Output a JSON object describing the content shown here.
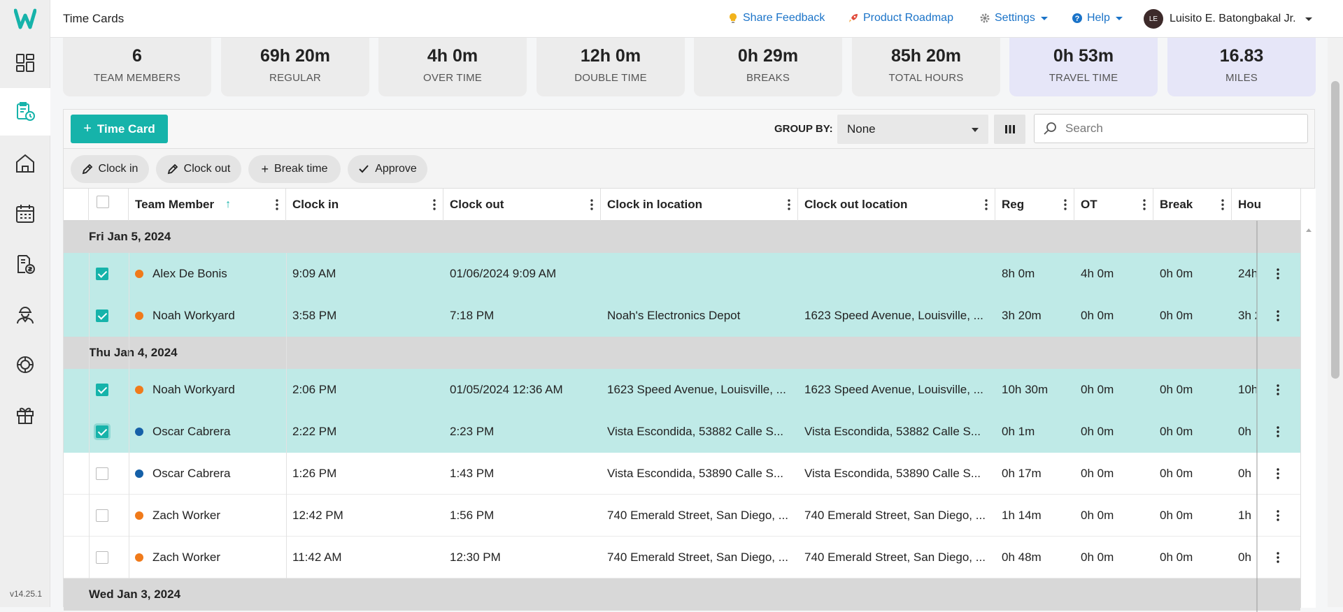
{
  "app": {
    "version": "v14.25.1"
  },
  "header": {
    "title": "Time Cards",
    "links": [
      {
        "label": "Share Feedback"
      },
      {
        "label": "Product Roadmap"
      },
      {
        "label": "Settings"
      },
      {
        "label": "Help"
      }
    ],
    "user": {
      "initials": "LE",
      "name": "Luisito E. Batongbakal Jr."
    }
  },
  "stats": [
    {
      "value": "6",
      "label": "TEAM MEMBERS"
    },
    {
      "value": "69h 20m",
      "label": "REGULAR"
    },
    {
      "value": "4h 0m",
      "label": "OVER TIME"
    },
    {
      "value": "12h 0m",
      "label": "DOUBLE TIME"
    },
    {
      "value": "0h 29m",
      "label": "BREAKS"
    },
    {
      "value": "85h 20m",
      "label": "TOTAL HOURS"
    },
    {
      "value": "0h 53m",
      "label": "TRAVEL TIME"
    },
    {
      "value": "16.83",
      "label": "MILES"
    }
  ],
  "toolbar": {
    "add_label": "Time Card",
    "group_by_label": "GROUP BY:",
    "group_by_value": "None",
    "search_placeholder": "Search"
  },
  "actions": [
    {
      "label": "Clock in"
    },
    {
      "label": "Clock out"
    },
    {
      "label": "Break time"
    },
    {
      "label": "Approve"
    }
  ],
  "columns": [
    "Team Member",
    "Clock in",
    "Clock out",
    "Clock in location",
    "Clock out location",
    "Reg",
    "OT",
    "Break",
    "Hou"
  ],
  "colors": {
    "accent": "#16b3aa",
    "selected_row": "#bfeae7",
    "orange_dot": "#f07a1a",
    "blue_dot": "#1560a8"
  },
  "groups": [
    {
      "label": "Fri Jan 5, 2024",
      "rows": [
        {
          "selected": true,
          "dot": "orange",
          "member": "Alex De Bonis",
          "clock_in": "9:09 AM",
          "clock_out": "01/06/2024 9:09 AM",
          "in_loc": "",
          "out_loc": "",
          "reg": "8h 0m",
          "ot": "4h 0m",
          "brk": "0h 0m",
          "hours": "24h"
        },
        {
          "selected": true,
          "dot": "orange",
          "member": "Noah Workyard",
          "clock_in": "3:58 PM",
          "clock_out": "7:18 PM",
          "in_loc": "Noah's Electronics Depot",
          "out_loc": "1623 Speed Avenue, Louisville, ...",
          "reg": "3h 20m",
          "ot": "0h 0m",
          "brk": "0h 0m",
          "hours": "3h 2"
        }
      ]
    },
    {
      "label": "Thu Jan 4, 2024",
      "rows": [
        {
          "selected": true,
          "dot": "orange",
          "member": "Noah Workyard",
          "clock_in": "2:06 PM",
          "clock_out": "01/05/2024 12:36 AM",
          "in_loc": "1623 Speed Avenue, Louisville, ...",
          "out_loc": "1623 Speed Avenue, Louisville, ...",
          "reg": "10h 30m",
          "ot": "0h 0m",
          "brk": "0h 0m",
          "hours": "10h"
        },
        {
          "selected": true,
          "focus": true,
          "dot": "blue",
          "member": "Oscar Cabrera",
          "clock_in": "2:22 PM",
          "clock_out": "2:23 PM",
          "in_loc": "Vista Escondida, 53882 Calle S...",
          "out_loc": "Vista Escondida, 53882 Calle S...",
          "reg": "0h 1m",
          "ot": "0h 0m",
          "brk": "0h 0m",
          "hours": "0h"
        },
        {
          "selected": false,
          "dot": "blue",
          "member": "Oscar Cabrera",
          "clock_in": "1:26 PM",
          "clock_out": "1:43 PM",
          "in_loc": "Vista Escondida, 53890 Calle S...",
          "out_loc": "Vista Escondida, 53890 Calle S...",
          "reg": "0h 17m",
          "ot": "0h 0m",
          "brk": "0h 0m",
          "hours": "0h"
        },
        {
          "selected": false,
          "dot": "orange",
          "member": "Zach Worker",
          "clock_in": "12:42 PM",
          "clock_out": "1:56 PM",
          "in_loc": "740 Emerald Street, San Diego, ...",
          "out_loc": "740 Emerald Street, San Diego, ...",
          "reg": "1h 14m",
          "ot": "0h 0m",
          "brk": "0h 0m",
          "hours": "1h"
        },
        {
          "selected": false,
          "dot": "orange",
          "member": "Zach Worker",
          "clock_in": "11:42 AM",
          "clock_out": "12:30 PM",
          "in_loc": "740 Emerald Street, San Diego, ...",
          "out_loc": "740 Emerald Street, San Diego, ...",
          "reg": "0h 48m",
          "ot": "0h 0m",
          "brk": "0h 0m",
          "hours": "0h"
        }
      ]
    },
    {
      "label": "Wed Jan 3, 2024",
      "rows": []
    }
  ]
}
